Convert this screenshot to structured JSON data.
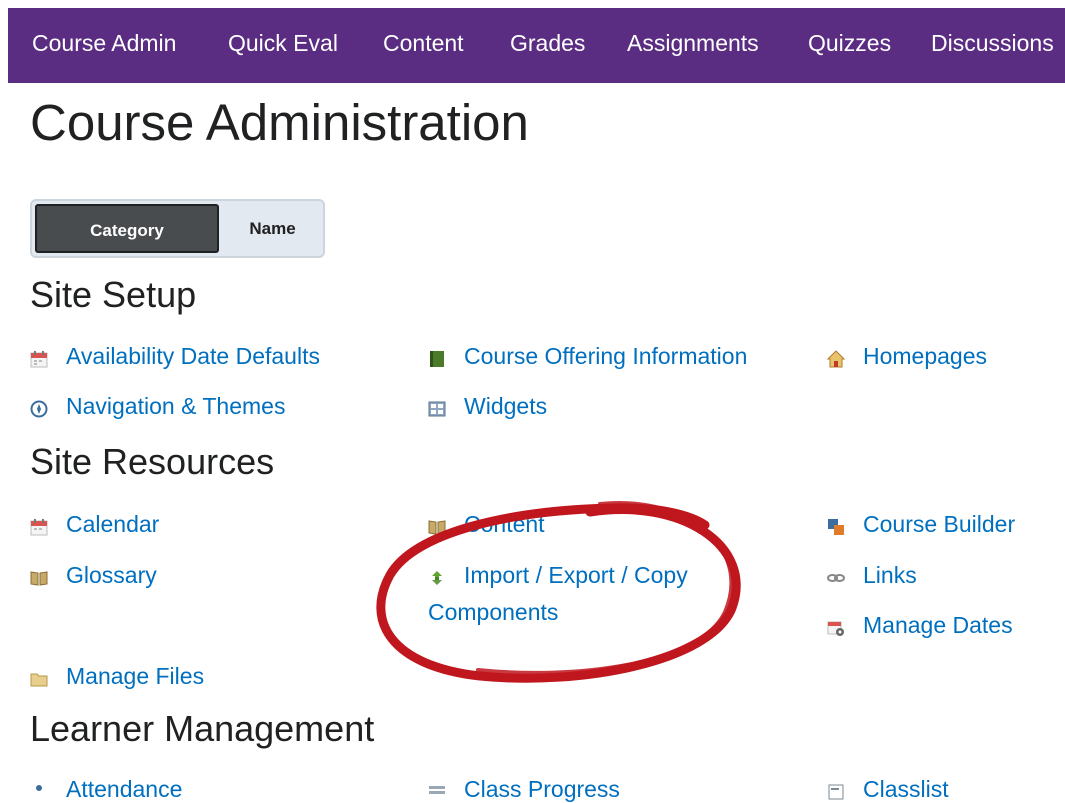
{
  "nav": {
    "items": [
      "Course Admin",
      "Quick Eval",
      "Content",
      "Grades",
      "Assignments",
      "Quizzes",
      "Discussions"
    ]
  },
  "page": {
    "title": "Course Administration"
  },
  "toggle": {
    "category": "Category",
    "name": "Name",
    "active": "Category"
  },
  "sections": {
    "site_setup": {
      "heading": "Site Setup",
      "links": [
        "Availability Date Defaults",
        "Course Offering Information",
        "Homepages",
        "Navigation & Themes",
        "Widgets"
      ]
    },
    "site_resources": {
      "heading": "Site Resources",
      "links": [
        "Calendar",
        "Content",
        "Course Builder",
        "Glossary",
        "Import / Export / Copy",
        "Components",
        "Links",
        "Manage Dates",
        "Manage Files"
      ]
    },
    "learner_management": {
      "heading": "Learner Management",
      "links": [
        "Attendance",
        "Class Progress",
        "Classlist"
      ]
    }
  },
  "colors": {
    "nav_bg": "#5a2d82",
    "link": "#006fbf",
    "annotation": "#c0161d",
    "toggle_active": "#494c4e"
  }
}
